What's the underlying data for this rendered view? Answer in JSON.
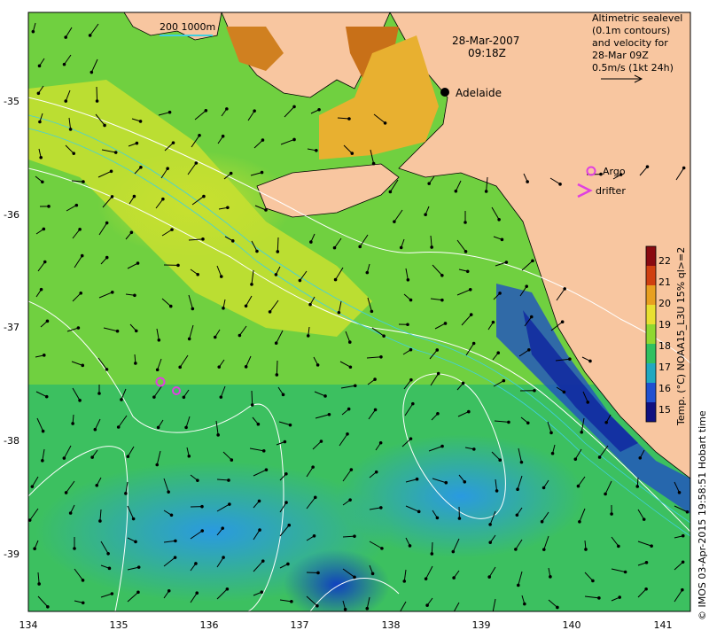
{
  "map": {
    "date": "28-Mar-2007",
    "time": "09:18Z",
    "scale_label": "200  1000m",
    "place": "Adelaide",
    "info_lines": [
      "Altimetric sealevel",
      "(0.1m contours)",
      "and velocity for",
      "28-Mar 09Z",
      "0.5m/s (1kt 24h)"
    ],
    "legend_argo": "Argo",
    "legend_drifter": "drifter",
    "credit": "© IMOS 03-Apr-2015 19:58:51 Hobart time",
    "colorbar_label": "Temp. (°C) NOAA15_L3U 15% ql>=2",
    "colorbar_ticks": [
      "22",
      "21",
      "20",
      "19",
      "18",
      "17",
      "16",
      "15"
    ],
    "x_ticks": [
      "134",
      "135",
      "136",
      "137",
      "138",
      "139",
      "140",
      "141"
    ],
    "y_ticks": [
      "-35",
      "-36",
      "-37",
      "-38",
      "-39"
    ],
    "colors": {
      "land": "#f8c6a0",
      "warm_water": "#d9a020",
      "mid_water": "#8fdd30",
      "cool_water": "#22a0d0",
      "cold_water": "#2030b0",
      "contour": "#ffffff",
      "argo": "#e040e0"
    }
  }
}
